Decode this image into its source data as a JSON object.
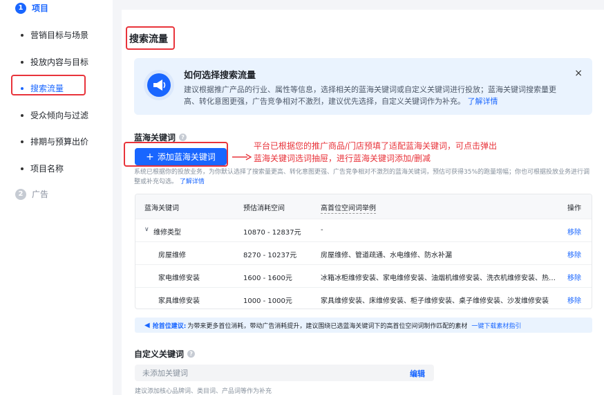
{
  "sidebar": {
    "step1": {
      "num": "1",
      "label": "项目"
    },
    "items": [
      {
        "label": "营销目标与场景"
      },
      {
        "label": "投放内容与目标"
      },
      {
        "label": "搜索流量"
      },
      {
        "label": "受众倾向与过滤"
      },
      {
        "label": "排期与预算出价"
      },
      {
        "label": "项目名称"
      }
    ],
    "step2": {
      "num": "2",
      "label": "广告"
    }
  },
  "main": {
    "title": "搜索流量",
    "info": {
      "title": "如何选择搜索流量",
      "desc": "建议根据推广产品的行业、属性等信息，选择相关的蓝海关键词或自定义关键词进行投放；蓝海关键词搜索量更高、转化意图更强，广告竞争相对不激烈，建议优先选择，自定义关键词作为补充。",
      "link": "了解详情",
      "close": "×"
    },
    "blue_kw": {
      "label": "蓝海关键词",
      "help": "?",
      "add_button": "添加蓝海关键词",
      "annotation_line1": "平台已根据您的推广商品/门店预填了适配蓝海关键词，可点击弹出",
      "annotation_line2": "蓝海关键词选词抽屉，进行蓝海关键词添加/删减",
      "hint": "系统已根据你的投放业务，为你默认选择了搜索量更高、转化意图更强、广告竞争相对不激烈的蓝海关键词，预估可获得35%的跑量增幅；你也可根据投放业务进行调整或补充勾选。",
      "hint_link": "了解详情"
    },
    "table": {
      "headers": {
        "kw": "蓝海关键词",
        "space": "预估消耗空间",
        "examples": "高首位空间词举例",
        "op": "操作"
      },
      "rows": [
        {
          "kw": "维修类型",
          "space": "10870 - 12837元",
          "examples": "-",
          "op": "移除"
        },
        {
          "kw": "房屋维修",
          "space": "8270 - 10237元",
          "examples": "房屋维修、管道疏通、水电维修、防水补漏",
          "op": "移除"
        },
        {
          "kw": "家电维修安装",
          "space": "1600 - 1600元",
          "examples": "冰箱冰柜维修安装、家电维修安装、油烟机维修安装、洗衣机维修安装、热…",
          "op": "移除"
        },
        {
          "kw": "家具维修安装",
          "space": "1000 - 1000元",
          "examples": "家具维修安装、床维修安装、柜子维修安装、桌子维修安装、沙发维修安装",
          "op": "移除"
        }
      ]
    },
    "tip": {
      "key": "抢首位建议:",
      "text": "为带来更多首位消耗，带动广告消耗提升，建议围绕已选蓝海关键词下的高首位空间词制作匹配的素材",
      "link": "一键下载素材指引"
    },
    "custom_kw": {
      "label": "自定义关键词",
      "help": "?",
      "placeholder": "未添加关键词",
      "edit": "编辑",
      "hint": "建议添加核心品牌词、类目词、产品词等作为补充"
    }
  },
  "colors": {
    "accent": "#1966ff",
    "annotation": "#e8333a"
  }
}
